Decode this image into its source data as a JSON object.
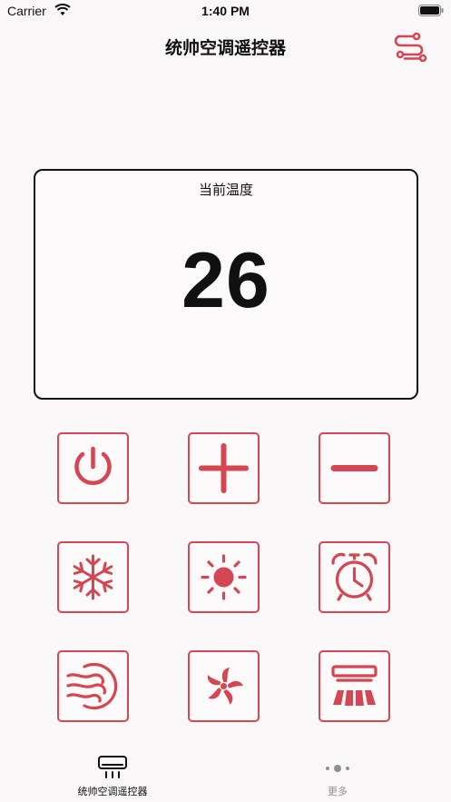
{
  "status": {
    "carrier": "Carrier",
    "time": "1:40 PM"
  },
  "header": {
    "title": "统帅空调遥控器",
    "settings_icon": "sliders-icon"
  },
  "temperature": {
    "label": "当前温度",
    "value": "26"
  },
  "controls": [
    {
      "name": "power",
      "icon": "power-icon"
    },
    {
      "name": "temp-up",
      "icon": "plus-icon"
    },
    {
      "name": "temp-down",
      "icon": "minus-icon"
    },
    {
      "name": "cool-mode",
      "icon": "snowflake-icon"
    },
    {
      "name": "heat-mode",
      "icon": "sun-icon"
    },
    {
      "name": "timer",
      "icon": "alarm-clock-icon"
    },
    {
      "name": "dry-mode",
      "icon": "wind-icon"
    },
    {
      "name": "fan-mode",
      "icon": "fan-icon"
    },
    {
      "name": "swing",
      "icon": "ac-swing-icon"
    }
  ],
  "tabs": [
    {
      "label": "统帅空调遥控器",
      "icon": "air-conditioner-icon",
      "active": true
    },
    {
      "label": "更多",
      "icon": "more-dots-icon",
      "active": false
    }
  ],
  "colors": {
    "accent": "#d34652",
    "text": "#111111",
    "inactive": "#8e8e93",
    "background": "#f9f7f8"
  }
}
